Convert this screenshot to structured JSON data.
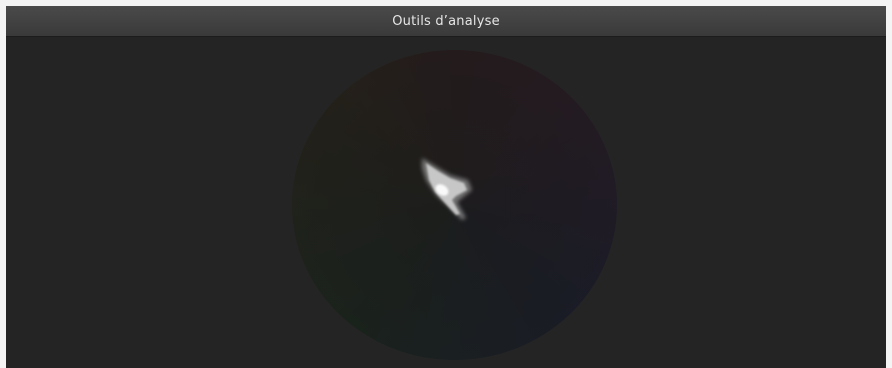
{
  "window": {
    "title": "Outils d’analyse"
  },
  "scope": {
    "type": "vectorscope",
    "icon": "vectorscope-trace"
  }
}
